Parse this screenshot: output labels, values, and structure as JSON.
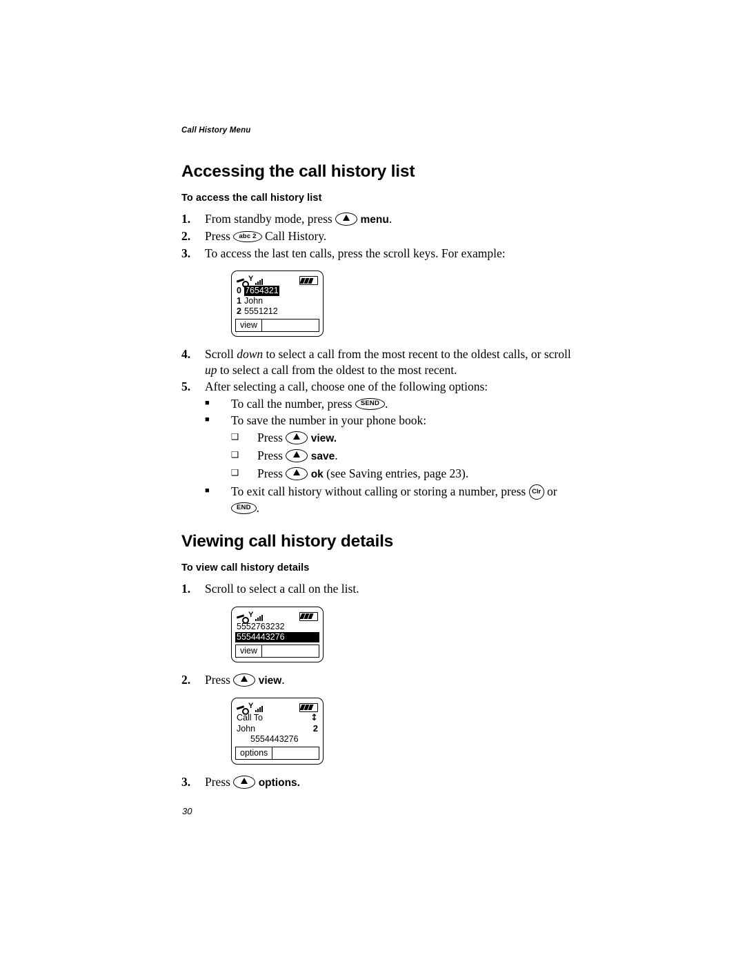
{
  "document": {
    "running_header": "Call History Menu",
    "page_number": "30"
  },
  "section_one": {
    "title": "Accessing the call history list",
    "task_title": "To access the call history list",
    "steps": [
      {
        "number": "1.",
        "text_before": "From standby mode, press",
        "key": "scroll",
        "bold_label": "menu",
        "text_after": "."
      },
      {
        "number": "2.",
        "text_before": "Press",
        "key": "abc 2",
        "text_after": "Call History."
      },
      {
        "number": "3.",
        "text_before": "To access the last ten calls, press the scroll keys. For example:"
      },
      {
        "number": "4.",
        "text_part_1": "Scroll",
        "italic_1": "down",
        "text_part_2": "to select a call from the most recent to the oldest calls, or scroll",
        "italic_2": "up",
        "text_part_3": "to select a call from the oldest to the most recent."
      },
      {
        "number": "5.",
        "text_before": "After selecting a call, choose one of the following options:"
      }
    ],
    "bullets": [
      {
        "mark": "■",
        "text_before": "To call the number, press",
        "key": "SEND",
        "text_after": "."
      },
      {
        "mark": "■",
        "text_before": "To save the number in your phone book:"
      }
    ],
    "subbullets": [
      {
        "mark": "❑",
        "text_before": "Press",
        "key": "scroll",
        "bold_label": "view",
        "text_after": "."
      },
      {
        "mark": "❑",
        "text_before": "Press",
        "key": "scroll",
        "bold_label": "save",
        "text_after": "."
      },
      {
        "mark": "❑",
        "text_before": "Press",
        "key": "scroll",
        "bold_label": "ok",
        "text_after": "(see Saving entries, page 23)."
      }
    ],
    "exit_bullet": {
      "mark": "■",
      "text_before": "To exit call history without calling or storing a number, press",
      "key_1": "Clr",
      "text_middle": "or",
      "key_2": "END",
      "text_after": "."
    }
  },
  "section_two": {
    "title": "Viewing call history details",
    "task_title": "To view call history details",
    "steps": [
      {
        "number": "1.",
        "text_before": "Scroll to select a call on the list."
      },
      {
        "number": "2.",
        "text_before": "Press",
        "key": "scroll",
        "bold_label": "view",
        "text_after": "."
      },
      {
        "number": "3.",
        "text_before": "Press",
        "key": "scroll",
        "bold_label": "options",
        "text_after": "."
      }
    ]
  },
  "phone_screens": [
    {
      "name": "call-history-list-indexed",
      "status": {
        "roaming_icon": "roam-icon",
        "antenna_icon": "antenna-icon",
        "signal_icon": "signal-bars-icon",
        "battery_icon": "battery-icon"
      },
      "rows": [
        {
          "index": "0",
          "value": "7654321",
          "highlighted": true
        },
        {
          "index": "1",
          "value": "John",
          "highlighted": false
        },
        {
          "index": "2",
          "value": "5551212",
          "highlighted": false
        }
      ],
      "softkey": "view"
    },
    {
      "name": "call-history-list-numbers",
      "status": {
        "roaming_icon": "roam-icon",
        "antenna_icon": "antenna-icon",
        "signal_icon": "signal-bars-icon",
        "battery_icon": "battery-icon"
      },
      "rows": [
        {
          "value": "5552763232",
          "highlighted": false
        },
        {
          "value": "5554443276",
          "highlighted": true
        }
      ],
      "softkey": "view"
    },
    {
      "name": "call-detail-view",
      "status": {
        "roaming_icon": "roam-icon",
        "antenna_icon": "antenna-icon",
        "signal_icon": "signal-bars-icon",
        "battery_icon": "battery-icon"
      },
      "label_line": "Call To",
      "scroll_arrow": "↕",
      "name_line": "John",
      "count": "2",
      "number_line": "5554443276",
      "softkey": "options"
    }
  ]
}
